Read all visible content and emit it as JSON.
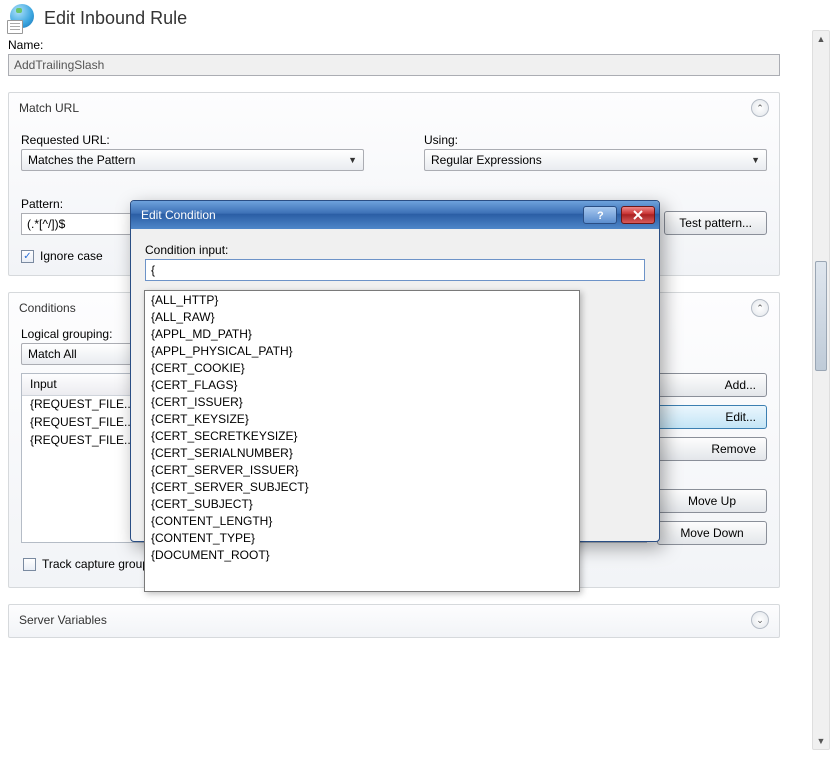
{
  "header": {
    "title": "Edit Inbound Rule"
  },
  "name": {
    "label": "Name:",
    "value": "AddTrailingSlash"
  },
  "match_url": {
    "title": "Match URL",
    "requested_label": "Requested URL:",
    "requested_value": "Matches the Pattern",
    "using_label": "Using:",
    "using_value": "Regular Expressions",
    "pattern_label": "Pattern:",
    "pattern_value": "(.*[^/])$",
    "test_label": "Test pattern...",
    "ignore_case_label": "Ignore case"
  },
  "conditions": {
    "title": "Conditions",
    "grouping_label": "Logical grouping:",
    "grouping_value": "Match All",
    "col_input": "Input",
    "rows": [
      {
        "input": "{REQUEST_FILE..."
      },
      {
        "input": "{REQUEST_FILE..."
      },
      {
        "input": "{REQUEST_FILE..."
      }
    ],
    "btn_add": "Add...",
    "btn_edit": "Edit...",
    "btn_remove": "Remove",
    "btn_up": "Move Up",
    "btn_down": "Move Down",
    "track_label": "Track capture groups across conditions"
  },
  "server_vars": {
    "title": "Server Variables"
  },
  "dialog": {
    "title": "Edit Condition",
    "input_label": "Condition input:",
    "input_value": "{",
    "options": [
      "{ALL_HTTP}",
      "{ALL_RAW}",
      "{APPL_MD_PATH}",
      "{APPL_PHYSICAL_PATH}",
      "{CERT_COOKIE}",
      "{CERT_FLAGS}",
      "{CERT_ISSUER}",
      "{CERT_KEYSIZE}",
      "{CERT_SECRETKEYSIZE}",
      "{CERT_SERIALNUMBER}",
      "{CERT_SERVER_ISSUER}",
      "{CERT_SERVER_SUBJECT}",
      "{CERT_SUBJECT}",
      "{CONTENT_LENGTH}",
      "{CONTENT_TYPE}",
      "{DOCUMENT_ROOT}"
    ]
  }
}
